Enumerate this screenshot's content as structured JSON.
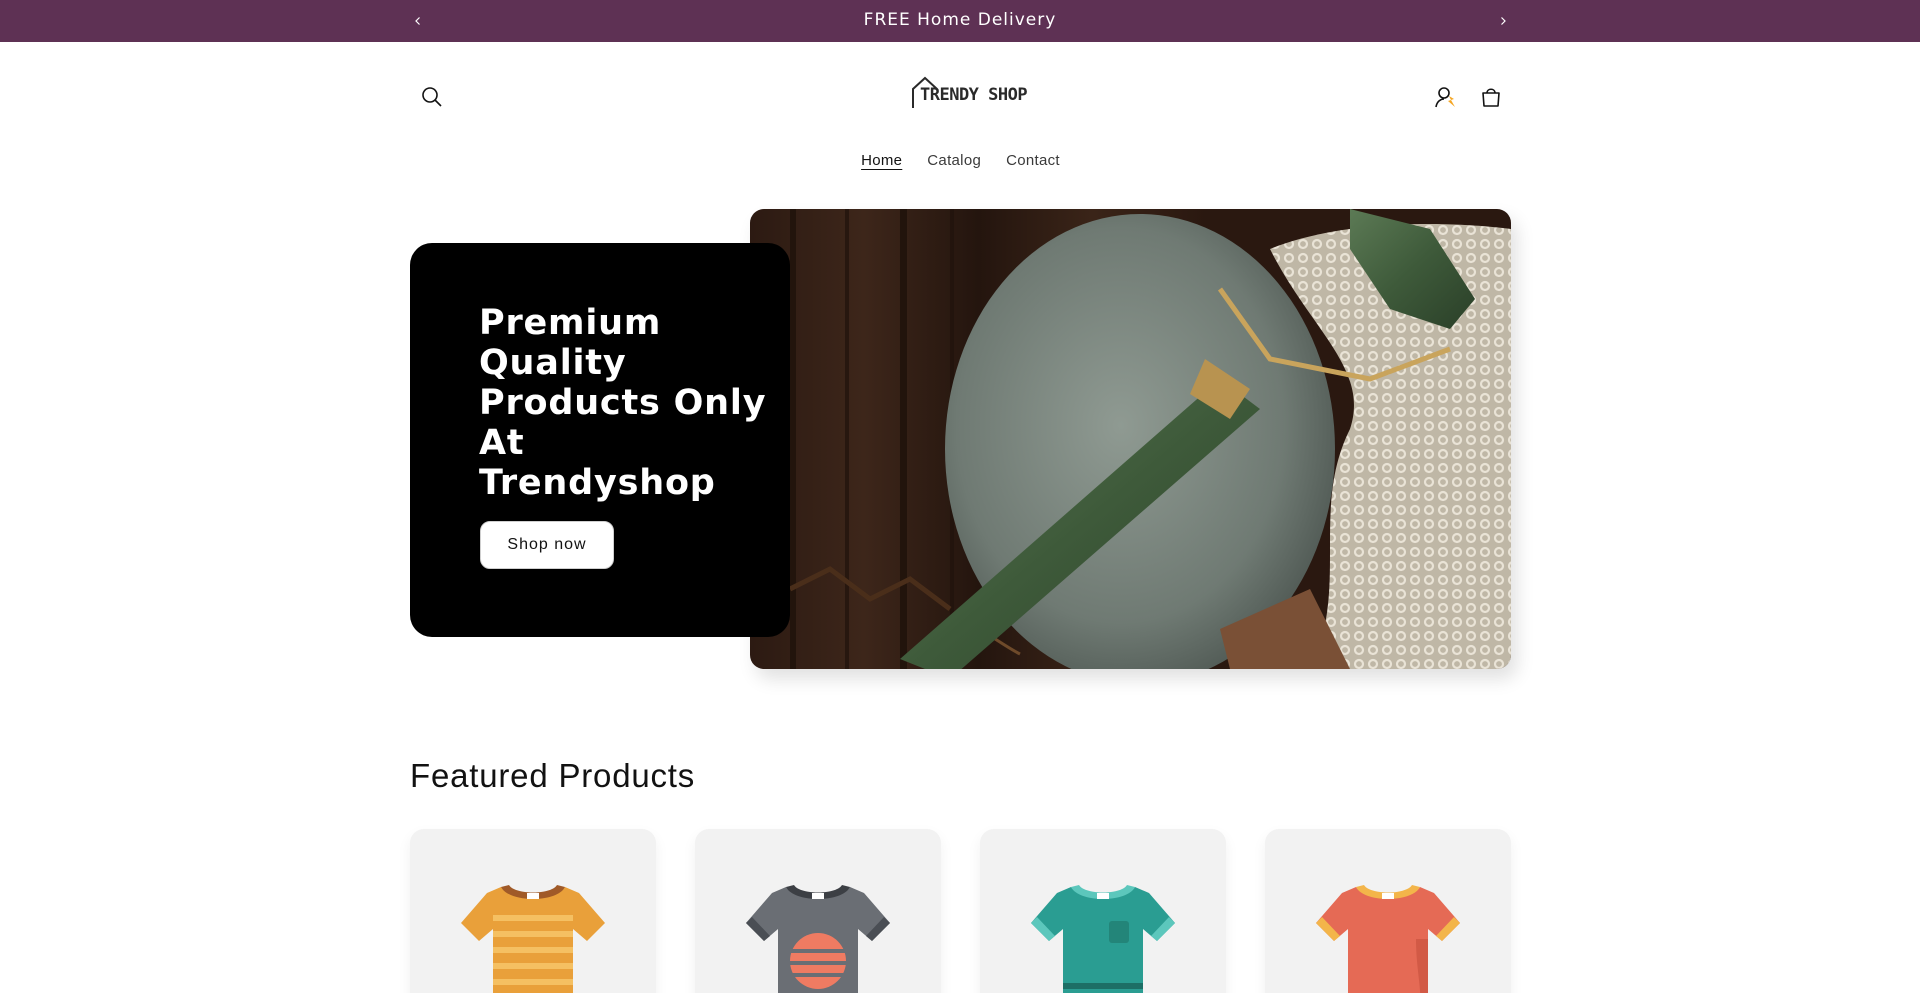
{
  "announcement": {
    "message": "FREE Home Delivery",
    "prev_icon": "chevron-left-icon",
    "next_icon": "chevron-right-icon",
    "bg_color": "#5e3154"
  },
  "header": {
    "logo_text": "TRENDY SHOP",
    "search_icon": "search-icon",
    "account_icon": "account-icon",
    "cart_icon": "cart-icon"
  },
  "nav": {
    "items": [
      {
        "label": "Home",
        "active": true
      },
      {
        "label": "Catalog",
        "active": false
      },
      {
        "label": "Contact",
        "active": false
      }
    ]
  },
  "hero": {
    "heading": "Premium Quality Products Only At Trendyshop",
    "button_label": "Shop now"
  },
  "featured": {
    "title": "Featured Products",
    "products": [
      {
        "icon": "orange-striped-tshirt-icon",
        "color": "#e9a03a"
      },
      {
        "icon": "gray-sunset-tshirt-icon",
        "color": "#6a6e74"
      },
      {
        "icon": "teal-pocket-tshirt-icon",
        "color": "#2a9d92"
      },
      {
        "icon": "coral-tshirt-icon",
        "color": "#e56a55"
      }
    ]
  }
}
